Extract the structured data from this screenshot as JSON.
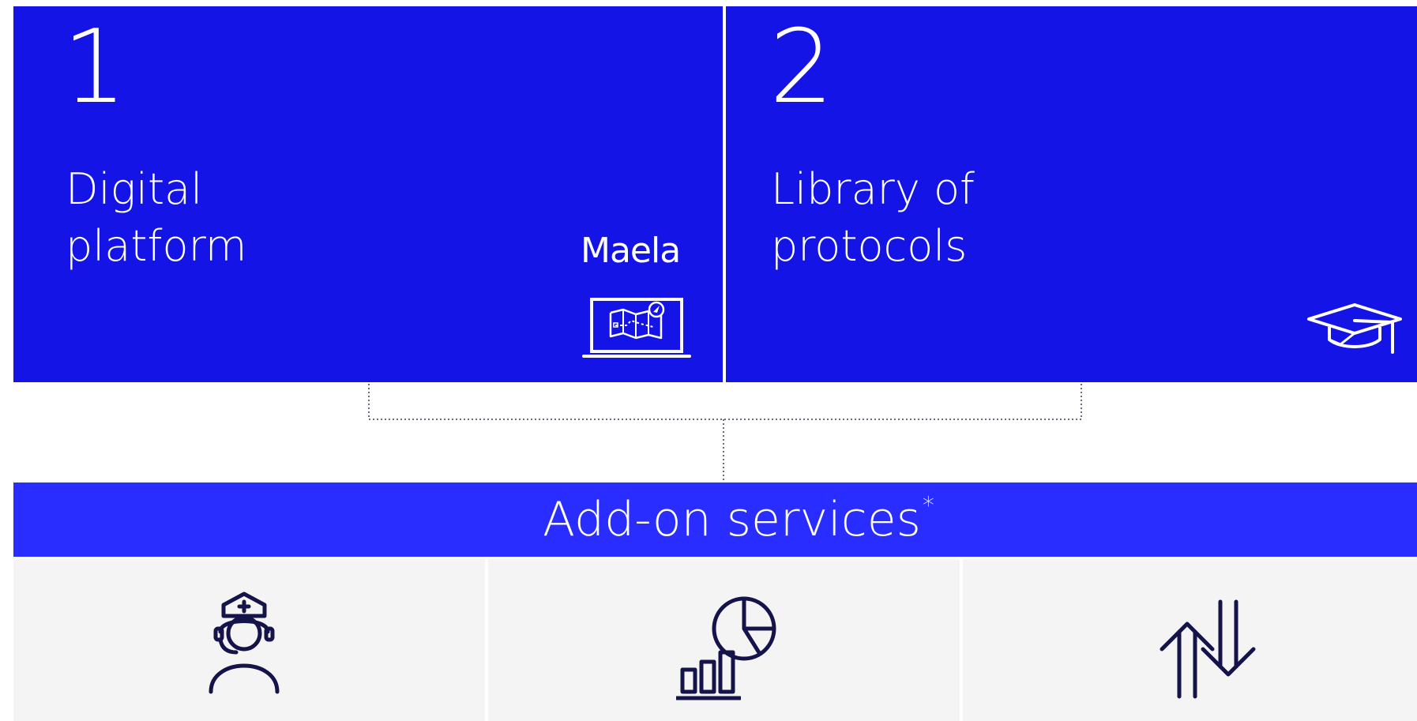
{
  "tiles": [
    {
      "number": "1",
      "title_line1": "Digital",
      "title_line2": "platform",
      "logo_text": "Maela",
      "icon": "laptop-map-icon"
    },
    {
      "number": "2",
      "title_line1": "Library of",
      "title_line2": "protocols",
      "icon": "graduation-cap-icon"
    }
  ],
  "addon": {
    "title": "Add-on services",
    "footnote_mark": "*"
  },
  "services": [
    {
      "icon": "nurse-headset-icon"
    },
    {
      "icon": "analytics-chart-icon"
    },
    {
      "icon": "data-exchange-arrows-icon"
    }
  ],
  "colors": {
    "tile_blue": "#1414e6",
    "addon_blue": "#2a2dff",
    "panel_grey": "#f4f4f4",
    "icon_navy": "#14144a"
  }
}
